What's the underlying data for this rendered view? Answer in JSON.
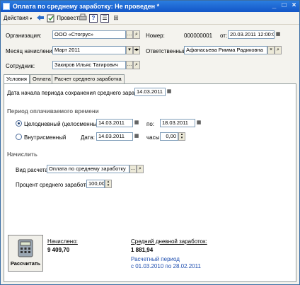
{
  "window": {
    "title": "Оплата по среднему заработку: Не проведен *"
  },
  "toolbar": {
    "actions": "Действия",
    "post": "Провести"
  },
  "header": {
    "org_label": "Организация:",
    "org_value": "ООО «Стогрус»",
    "month_label": "Месяц начисления:",
    "month_value": "Март 2011",
    "employee_label": "Сотрудник:",
    "employee_value": "Закиров Ильяс Тагирович",
    "number_label": "Номер:",
    "number_value": "000000001",
    "date_prefix": "от:",
    "date_value": "20.03.2011 12:00:00",
    "responsible_label": "Ответственный:",
    "responsible_value": "Афанасьева Римма Радиковна"
  },
  "tabs": [
    {
      "label": "Условия"
    },
    {
      "label": "Оплата"
    },
    {
      "label": "Расчет среднего заработка"
    }
  ],
  "conditions": {
    "start_label": "Дата начала периода сохранения среднего заработка:",
    "start_value": "14.03.2011",
    "period_title": "Период оплачиваемого времени",
    "whole_day_label": "Целодневный (целосменный) с:",
    "whole_from": "14.03.2011",
    "whole_to_label": "по:",
    "whole_to": "18.03.2011",
    "intraday_label": "Внутрисменный",
    "intraday_date_label": "Дата:",
    "intraday_date": "14.03.2011",
    "hours_label": "часы:",
    "hours_value": "0,00",
    "accrue_title": "Начислить",
    "calc_type_label": "Вид расчета:",
    "calc_type_value": "Оплата по среднему заработку",
    "percent_label": "Процент среднего заработка:",
    "percent_value": "100,00"
  },
  "footer": {
    "calc_button": "Рассчитать",
    "accrued_label": "Начислено:",
    "accrued_value": "9 409,70",
    "avg_label": "Средний дневной заработок:",
    "avg_value": "1 881,94",
    "period_label": "Расчетный период",
    "period_value": "с 01.03.2010 по 28.02.2011"
  }
}
